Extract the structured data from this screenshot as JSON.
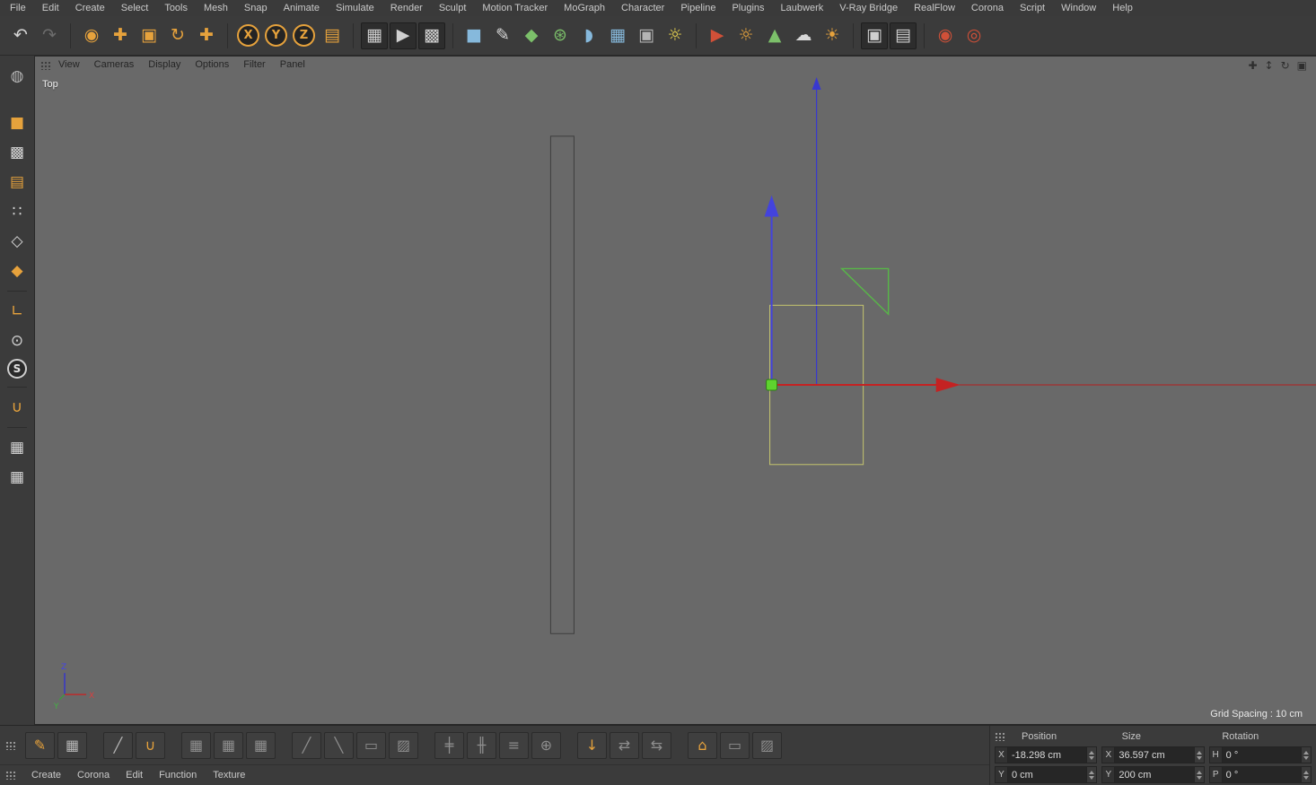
{
  "colors": {
    "panel_bg": "#3b3b3b",
    "viewport_bg": "#696969",
    "accent_orange": "#e6a23c",
    "selection_yellow": "#c6c66e",
    "axis_red": "#c42222",
    "axis_blue": "#3a3ad4",
    "handle_green": "#5ed32e"
  },
  "menubar": {
    "items": [
      {
        "label": "File",
        "name": "menu-file"
      },
      {
        "label": "Edit",
        "name": "menu-edit"
      },
      {
        "label": "Create",
        "name": "menu-create"
      },
      {
        "label": "Select",
        "name": "menu-select"
      },
      {
        "label": "Tools",
        "name": "menu-tools"
      },
      {
        "label": "Mesh",
        "name": "menu-mesh"
      },
      {
        "label": "Snap",
        "name": "menu-snap"
      },
      {
        "label": "Animate",
        "name": "menu-animate"
      },
      {
        "label": "Simulate",
        "name": "menu-simulate"
      },
      {
        "label": "Render",
        "name": "menu-render"
      },
      {
        "label": "Sculpt",
        "name": "menu-sculpt"
      },
      {
        "label": "Motion Tracker",
        "name": "menu-motion-tracker"
      },
      {
        "label": "MoGraph",
        "name": "menu-mograph"
      },
      {
        "label": "Character",
        "name": "menu-character"
      },
      {
        "label": "Pipeline",
        "name": "menu-pipeline"
      },
      {
        "label": "Plugins",
        "name": "menu-plugins"
      },
      {
        "label": "Laubwerk",
        "name": "menu-laubwerk"
      },
      {
        "label": "V-Ray Bridge",
        "name": "menu-vray-bridge"
      },
      {
        "label": "RealFlow",
        "name": "menu-realflow"
      },
      {
        "label": "Corona",
        "name": "menu-corona"
      },
      {
        "label": "Script",
        "name": "menu-script"
      },
      {
        "label": "Window",
        "name": "menu-window"
      },
      {
        "label": "Help",
        "name": "menu-help"
      }
    ]
  },
  "toolbar": {
    "icons": [
      {
        "glyph": "↶",
        "name": "undo-icon",
        "variant": "light"
      },
      {
        "glyph": "↷",
        "name": "redo-icon",
        "variant": "disabled"
      },
      {
        "variant": "sep",
        "name": "separator",
        "interactable": "false"
      },
      {
        "glyph": "◉",
        "name": "live-selection-icon",
        "variant": "orange"
      },
      {
        "glyph": "✚",
        "name": "move-tool-icon",
        "variant": "orange"
      },
      {
        "glyph": "▣",
        "name": "scale-tool-icon",
        "variant": "orange"
      },
      {
        "glyph": "↻",
        "name": "rotate-tool-icon",
        "variant": "orange"
      },
      {
        "glyph": "✚",
        "name": "last-used-tool-icon",
        "variant": "orange"
      },
      {
        "variant": "sep",
        "name": "separator",
        "interactable": "false"
      },
      {
        "glyph": "X",
        "name": "lock-x-axis-icon",
        "variant": "axis"
      },
      {
        "glyph": "Y",
        "name": "lock-y-axis-icon",
        "variant": "axis"
      },
      {
        "glyph": "Z",
        "name": "lock-z-axis-icon",
        "variant": "axis"
      },
      {
        "glyph": "▤",
        "name": "coordinate-system-icon",
        "variant": "orange"
      },
      {
        "variant": "sep",
        "name": "separator",
        "interactable": "false"
      },
      {
        "glyph": "▦",
        "name": "render-view-icon",
        "variant": "dark"
      },
      {
        "glyph": "▶",
        "name": "render-picture-viewer-icon",
        "variant": "dark"
      },
      {
        "glyph": "▩",
        "name": "render-settings-icon",
        "variant": "dark"
      },
      {
        "variant": "sep",
        "name": "separator",
        "interactable": "false"
      },
      {
        "glyph": "■",
        "name": "add-cube-icon",
        "variant": "blue"
      },
      {
        "glyph": "✎",
        "name": "add-spline-icon",
        "variant": "light"
      },
      {
        "glyph": "◆",
        "name": "mograph-icon",
        "variant": "green"
      },
      {
        "glyph": "⊛",
        "name": "simulate-icon",
        "variant": "green"
      },
      {
        "glyph": "◗",
        "name": "add-deformer-icon",
        "variant": "blue"
      },
      {
        "glyph": "▦",
        "name": "add-environment-icon",
        "variant": "blue"
      },
      {
        "glyph": "▣",
        "name": "add-camera-icon",
        "variant": "gray"
      },
      {
        "glyph": "☼",
        "name": "add-light-icon",
        "variant": "yellow"
      },
      {
        "variant": "sep",
        "name": "separator",
        "interactable": "false"
      },
      {
        "glyph": "▶",
        "name": "vray-camera-icon",
        "variant": "red"
      },
      {
        "glyph": "☼",
        "name": "corona-light-icon",
        "variant": "orange"
      },
      {
        "glyph": "▲",
        "name": "laubwerk-plant-icon",
        "variant": "green"
      },
      {
        "glyph": "☁",
        "name": "corona-sky-icon",
        "variant": "light"
      },
      {
        "glyph": "☀",
        "name": "corona-sun-icon",
        "variant": "orange"
      },
      {
        "variant": "sep",
        "name": "separator",
        "interactable": "false"
      },
      {
        "glyph": "▣",
        "name": "interactive-render-region-icon",
        "variant": "dark"
      },
      {
        "glyph": "▤",
        "name": "picture-viewer-icon",
        "variant": "dark"
      },
      {
        "variant": "sep",
        "name": "separator",
        "interactable": "false"
      },
      {
        "glyph": "◉",
        "name": "corona-render-icon",
        "variant": "red"
      },
      {
        "glyph": "◎",
        "name": "corona-interactive-render-icon",
        "variant": "red"
      }
    ]
  },
  "sidebar": {
    "icons": [
      {
        "glyph": "◍",
        "name": "globe-icon",
        "variant": "gray"
      },
      {
        "variant": "gap",
        "name": "spacer",
        "interactable": "false"
      },
      {
        "glyph": "■",
        "name": "model-mode-icon",
        "variant": "orange"
      },
      {
        "glyph": "▩",
        "name": "texture-mode-icon",
        "variant": "light"
      },
      {
        "glyph": "▤",
        "name": "workplane-mode-icon",
        "variant": "orange"
      },
      {
        "glyph": "∷",
        "name": "points-mode-icon",
        "variant": "light"
      },
      {
        "glyph": "◇",
        "name": "edges-mode-icon",
        "variant": "light"
      },
      {
        "glyph": "◆",
        "name": "polygons-mode-icon",
        "variant": "orange"
      },
      {
        "variant": "sep",
        "name": "separator",
        "interactable": "false"
      },
      {
        "glyph": "∟",
        "name": "axis-mode-icon",
        "variant": "orange"
      },
      {
        "glyph": "⊙",
        "name": "mouse-input-icon",
        "variant": "light"
      },
      {
        "glyph": "S",
        "name": "viewport-solo-icon",
        "variant": "circle"
      },
      {
        "variant": "sep",
        "name": "separator",
        "interactable": "false"
      },
      {
        "glyph": "∪",
        "name": "enable-snap-icon",
        "variant": "orange"
      },
      {
        "variant": "sep",
        "name": "separator",
        "interactable": "false"
      },
      {
        "glyph": "▦",
        "name": "lock-workplane-icon",
        "variant": "light"
      },
      {
        "glyph": "▦",
        "name": "align-workplane-icon",
        "variant": "light"
      }
    ]
  },
  "viewport": {
    "view_label": "Top",
    "grid_spacing": "Grid Spacing : 10 cm",
    "menu_items": [
      {
        "label": "View",
        "name": "vp-menu-view"
      },
      {
        "label": "Cameras",
        "name": "vp-menu-cameras"
      },
      {
        "label": "Display",
        "name": "vp-menu-display"
      },
      {
        "label": "Options",
        "name": "vp-menu-options"
      },
      {
        "label": "Filter",
        "name": "vp-menu-filter"
      },
      {
        "label": "Panel",
        "name": "vp-menu-panel"
      }
    ],
    "nav_icons": [
      {
        "glyph": "✚",
        "name": "pan-view-icon"
      },
      {
        "glyph": "↕",
        "name": "zoom-view-icon"
      },
      {
        "glyph": "↻",
        "name": "rotate-view-icon"
      },
      {
        "glyph": "▣",
        "name": "toggle-panel-icon"
      }
    ],
    "axis_gizmo": {
      "x": "X",
      "y": "Y",
      "z": "Z"
    }
  },
  "bottom_toolbar": {
    "icons": [
      {
        "glyph": "✎",
        "name": "spline-pen-icon",
        "variant": "orange"
      },
      {
        "glyph": "▦",
        "name": "tweak-grid-icon",
        "variant": "gray"
      },
      {
        "variant": "gap",
        "name": "spacer",
        "interactable": "false"
      },
      {
        "glyph": "╱",
        "name": "brush-tool-icon",
        "variant": "gray"
      },
      {
        "glyph": "∪",
        "name": "magnet-tool-icon",
        "variant": "orange"
      },
      {
        "variant": "gap",
        "name": "spacer",
        "interactable": "false"
      },
      {
        "glyph": "▦",
        "name": "array-tool-icon",
        "variant": "dim"
      },
      {
        "glyph": "▦",
        "name": "clone-tool-icon",
        "variant": "dim"
      },
      {
        "glyph": "▦",
        "name": "instance-tool-icon",
        "variant": "dim"
      },
      {
        "variant": "gap",
        "name": "spacer",
        "interactable": "false"
      },
      {
        "glyph": "╱",
        "name": "knife-tool-icon",
        "variant": "dim"
      },
      {
        "glyph": "╲",
        "name": "line-cut-icon",
        "variant": "dim"
      },
      {
        "glyph": "▭",
        "name": "polygon-pen-icon",
        "variant": "dim"
      },
      {
        "glyph": "▨",
        "name": "plane-cut-icon",
        "variant": "dim"
      },
      {
        "variant": "gap",
        "name": "spacer",
        "interactable": "false"
      },
      {
        "glyph": "╪",
        "name": "edge-cut-icon",
        "variant": "dim"
      },
      {
        "glyph": "╫",
        "name": "loop-cut-icon",
        "variant": "dim"
      },
      {
        "glyph": "≡",
        "name": "slide-tool-icon",
        "variant": "dim"
      },
      {
        "glyph": "⊕",
        "name": "weld-tool-icon",
        "variant": "dim"
      },
      {
        "variant": "gap",
        "name": "spacer",
        "interactable": "false"
      },
      {
        "glyph": "↓",
        "name": "drop-to-floor-icon",
        "variant": "orange"
      },
      {
        "glyph": "⇄",
        "name": "transfer-tool-icon",
        "variant": "dim"
      },
      {
        "glyph": "⇆",
        "name": "mirror-tool-icon",
        "variant": "dim"
      },
      {
        "variant": "gap",
        "name": "spacer",
        "interactable": "false"
      },
      {
        "glyph": "⌂",
        "name": "extrude-tool-icon",
        "variant": "orange"
      },
      {
        "glyph": "▭",
        "name": "smooth-shift-icon",
        "variant": "dim"
      },
      {
        "glyph": "▨",
        "name": "matrix-extrude-icon",
        "variant": "dim"
      }
    ]
  },
  "material_menubar": {
    "items": [
      {
        "label": "Create",
        "name": "mat-menu-create"
      },
      {
        "label": "Corona",
        "name": "mat-menu-corona"
      },
      {
        "label": "Edit",
        "name": "mat-menu-edit"
      },
      {
        "label": "Function",
        "name": "mat-menu-function"
      },
      {
        "label": "Texture",
        "name": "mat-menu-texture"
      }
    ]
  },
  "coordinates": {
    "headers": {
      "position": "Position",
      "size": "Size",
      "rotation": "Rotation"
    },
    "rows": [
      {
        "pos_label": "X",
        "pos_value": "-18.298 cm",
        "size_label": "X",
        "size_value": "36.597 cm",
        "rot_label": "H",
        "rot_value": "0 °"
      },
      {
        "pos_label": "Y",
        "pos_value": "0 cm",
        "size_label": "Y",
        "size_value": "200 cm",
        "rot_label": "P",
        "rot_value": "0 °"
      }
    ]
  }
}
